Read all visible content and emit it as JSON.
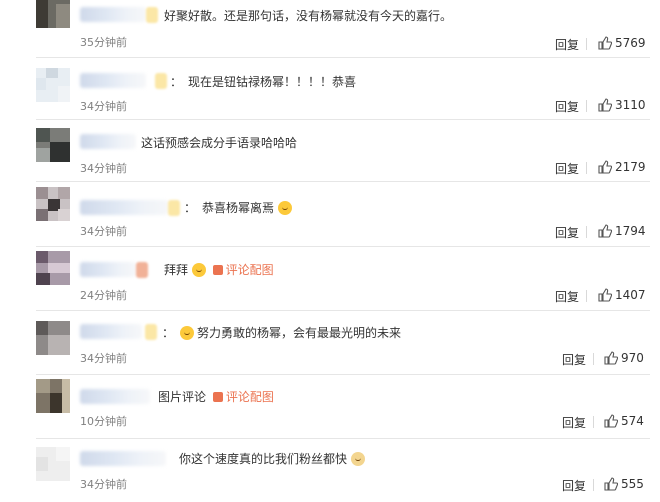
{
  "comments": [
    {
      "text": "好聚好散。还是那句话，没有杨幂就没有今天的嘉行。",
      "prefix_colon": "",
      "link": "",
      "emoji_after": "",
      "time": "35分钟前",
      "reply_label": "回复",
      "likes": "5769"
    },
    {
      "text": "现在是钮钴禄杨幂！！！！恭喜",
      "prefix_colon": "：",
      "link": "",
      "emoji_after": "",
      "time": "34分钟前",
      "reply_label": "回复",
      "likes": "3110"
    },
    {
      "text": "这话预感会成分手语录哈哈哈",
      "prefix_colon": "",
      "link": "",
      "emoji_after": "",
      "time": "34分钟前",
      "reply_label": "回复",
      "likes": "2179"
    },
    {
      "text": "恭喜杨幂离焉",
      "prefix_colon": "：",
      "link": "",
      "emoji_after": "shocked-emoji",
      "time": "34分钟前",
      "reply_label": "回复",
      "likes": "1794"
    },
    {
      "text": "拜拜",
      "prefix_colon": "",
      "link": "评论配图",
      "emoji_after": "wave-emoji",
      "time": "24分钟前",
      "reply_label": "回复",
      "likes": "1407"
    },
    {
      "text": "努力勇敢的杨幂，会有最最光明的未来",
      "prefix_colon": "：",
      "link": "",
      "emoji_before": "heart-face-emoji",
      "emoji_after": "",
      "time": "34分钟前",
      "reply_label": "回复",
      "likes": "970"
    },
    {
      "text": "图片评论",
      "prefix_colon": "",
      "link": "评论配图",
      "emoji_after": "",
      "time": "10分钟前",
      "reply_label": "回复",
      "likes": "574"
    },
    {
      "text": "你这个速度真的比我们粉丝都快",
      "prefix_colon": "",
      "link": "",
      "emoji_after": "doge-emoji",
      "time": "34分钟前",
      "reply_label": "回复",
      "likes": "555"
    }
  ],
  "icons": {
    "like": "thumbs-up-icon",
    "link": "image-icon"
  },
  "colors": {
    "link": "#eb7350",
    "time": "#808080",
    "text": "#333333"
  }
}
